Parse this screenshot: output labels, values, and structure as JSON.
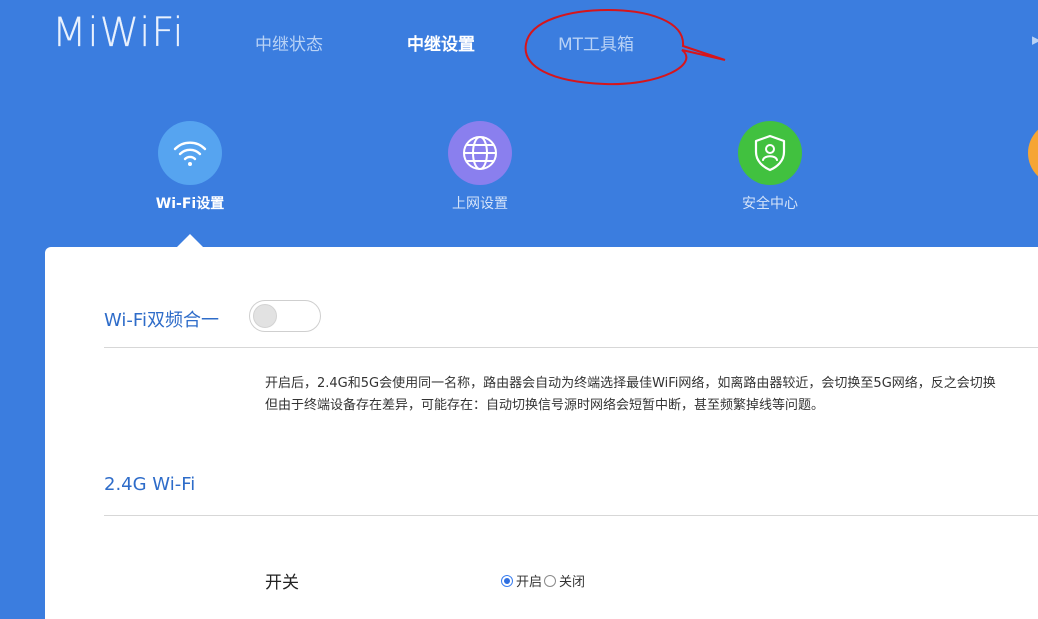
{
  "header": {
    "logo": "MiWiFi",
    "nav": [
      {
        "label": "中继状态",
        "active": false
      },
      {
        "label": "中继设置",
        "active": true
      },
      {
        "label": "MT工具箱",
        "active": false
      }
    ]
  },
  "features": [
    {
      "label": "Wi-Fi设置",
      "icon": "wifi-icon",
      "color": "#56a4f0",
      "active": true
    },
    {
      "label": "上网设置",
      "icon": "globe-icon",
      "color": "#8a7fee",
      "active": false
    },
    {
      "label": "安全中心",
      "icon": "shield-user-icon",
      "color": "#41c13f",
      "active": false
    },
    {
      "label": "",
      "icon": "partial-icon",
      "color": "#f6a534",
      "active": false
    }
  ],
  "panel": {
    "dual_band": {
      "title": "Wi-Fi双频合一",
      "toggle_on": false,
      "description_line1": "开启后，2.4G和5G会使用同一名称，路由器会自动为终端选择最佳WiFi网络，如离路由器较近，会切换至5G网络，反之会切换",
      "description_line2": "但由于终端设备存在差异，可能存在：自动切换信号源时网络会短暂中断，甚至频繁掉线等问题。"
    },
    "wifi_24g": {
      "title": "2.4G Wi-Fi",
      "switch_label": "开关",
      "options": [
        {
          "label": "开启",
          "checked": true
        },
        {
          "label": "关闭",
          "checked": false
        }
      ]
    }
  },
  "colors": {
    "background": "#3b7ddf",
    "accent": "#2e6cc9",
    "annotation": "#d6151b"
  }
}
